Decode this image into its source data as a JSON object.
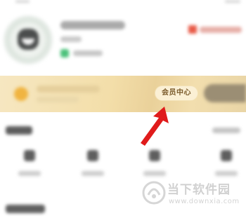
{
  "banner": {
    "member_center_label": "会员中心"
  },
  "watermark": {
    "text": "当下软件园",
    "url": "www.downxia.com"
  },
  "colors": {
    "banner_gold": "#f3dea9",
    "arrow_red": "#e01b1b",
    "member_text": "#7a5a2a"
  },
  "icons": {
    "arrow": "red-arrow-icon",
    "watermark_logo": "watermark-logo-icon"
  }
}
